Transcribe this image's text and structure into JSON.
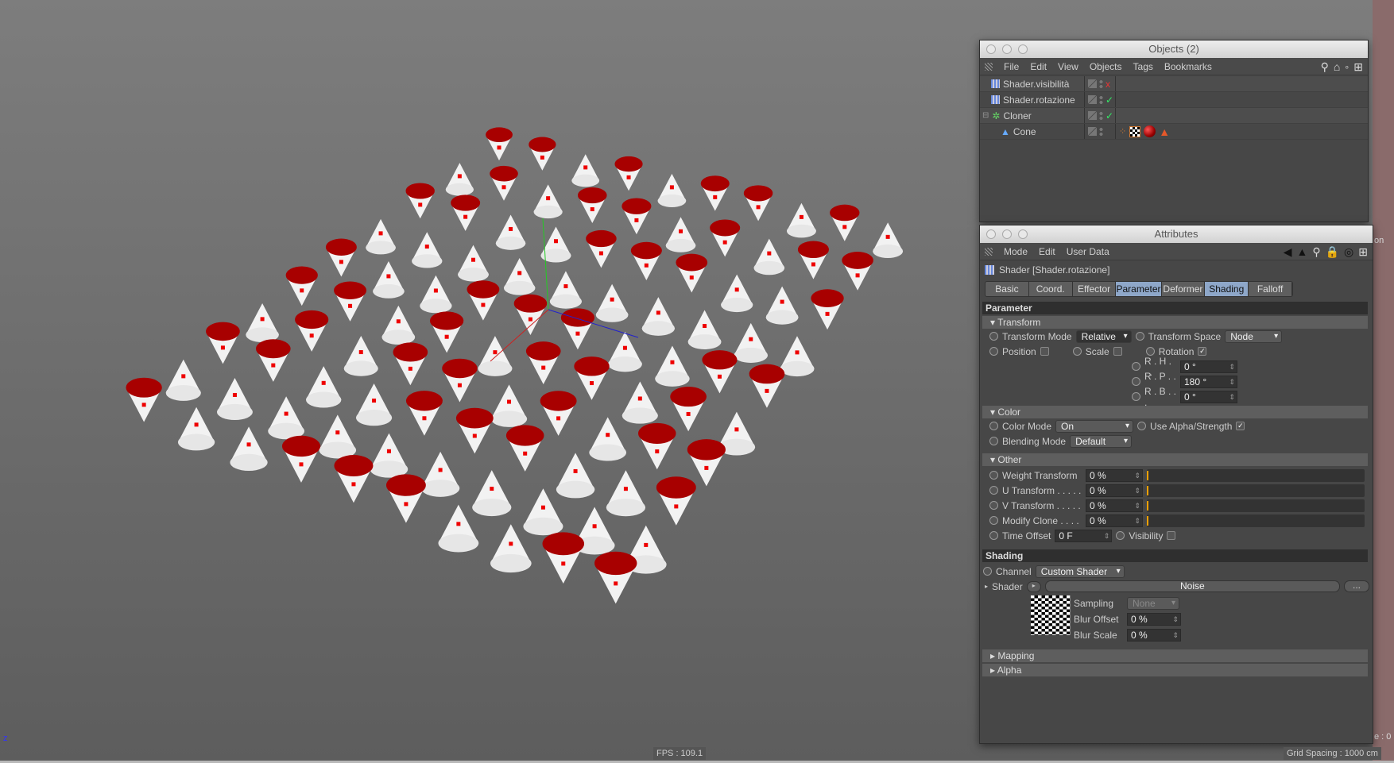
{
  "viewport": {
    "fps": "FPS : 109.1",
    "grid_spacing": "Grid Spacing : 1000 cm",
    "axis_label": "z",
    "edge_text_right": "e : 0",
    "edge_text_top": "on"
  },
  "colors": {
    "cone_white": "#f2f2f2",
    "cone_red": "#a80000",
    "selected_tab": "#8ea7c9"
  },
  "objects": {
    "title": "Objects (2)",
    "menu": [
      "File",
      "Edit",
      "View",
      "Objects",
      "Tags",
      "Bookmarks"
    ],
    "items": [
      {
        "name": "Shader.visibilità",
        "icon": "shader-effector-icon",
        "status": "x"
      },
      {
        "name": "Shader.rotazione",
        "icon": "shader-effector-icon",
        "status": "✓"
      },
      {
        "name": "Cloner",
        "icon": "cloner-icon",
        "status": "✓"
      },
      {
        "name": "Cone",
        "icon": "cone-icon",
        "status": "",
        "tags": [
          "phong-tag",
          "texture-tag",
          "material-tag",
          "display-tag"
        ]
      }
    ]
  },
  "attributes": {
    "title": "Attributes",
    "menu": [
      "Mode",
      "Edit",
      "User Data"
    ],
    "object_header": "Shader [Shader.rotazione]",
    "tabs": [
      {
        "label": "Basic",
        "active": false
      },
      {
        "label": "Coord.",
        "active": false
      },
      {
        "label": "Effector",
        "active": false
      },
      {
        "label": "Parameter",
        "active": true
      },
      {
        "label": "Deformer",
        "active": false
      },
      {
        "label": "Shading",
        "active": true
      },
      {
        "label": "Falloff",
        "active": false
      }
    ],
    "parameter": {
      "heading": "Parameter",
      "transform": {
        "label": "Transform",
        "mode_label": "Transform Mode",
        "mode": "Relative",
        "space_label": "Transform Space",
        "space": "Node",
        "position_label": "Position",
        "position": false,
        "scale_label": "Scale",
        "scale": false,
        "rotation_label": "Rotation",
        "rotation": true,
        "rh_label": "R . H . . .",
        "rh": "0 °",
        "rp_label": "R . P . . .",
        "rp": "180 °",
        "rb_label": "R . B . . .",
        "rb": "0 °"
      },
      "color": {
        "label": "Color",
        "mode_label": "Color Mode",
        "mode": "On",
        "alpha_label": "Use Alpha/Strength",
        "alpha": true,
        "blend_label": "Blending Mode",
        "blend": "Default"
      },
      "other": {
        "label": "Other",
        "weight_label": "Weight Transform",
        "weight": "0 %",
        "u_label": "U Transform . . . . .",
        "u": "0 %",
        "v_label": "V Transform . . . . .",
        "v": "0 %",
        "modify_label": "Modify Clone . . . .",
        "modify": "0 %",
        "time_label": "Time Offset",
        "time": "0 F",
        "visibility_label": "Visibility",
        "visibility": false
      }
    },
    "shading": {
      "heading": "Shading",
      "channel_label": "Channel",
      "channel": "Custom Shader",
      "shader_label": "Shader",
      "shader": "Noise",
      "more": "...",
      "sampling_label": "Sampling",
      "sampling": "None",
      "blur_offset_label": "Blur Offset",
      "blur_offset": "0 %",
      "blur_scale_label": "Blur Scale",
      "blur_scale": "0 %",
      "mapping": "Mapping",
      "alpha": "Alpha"
    }
  }
}
